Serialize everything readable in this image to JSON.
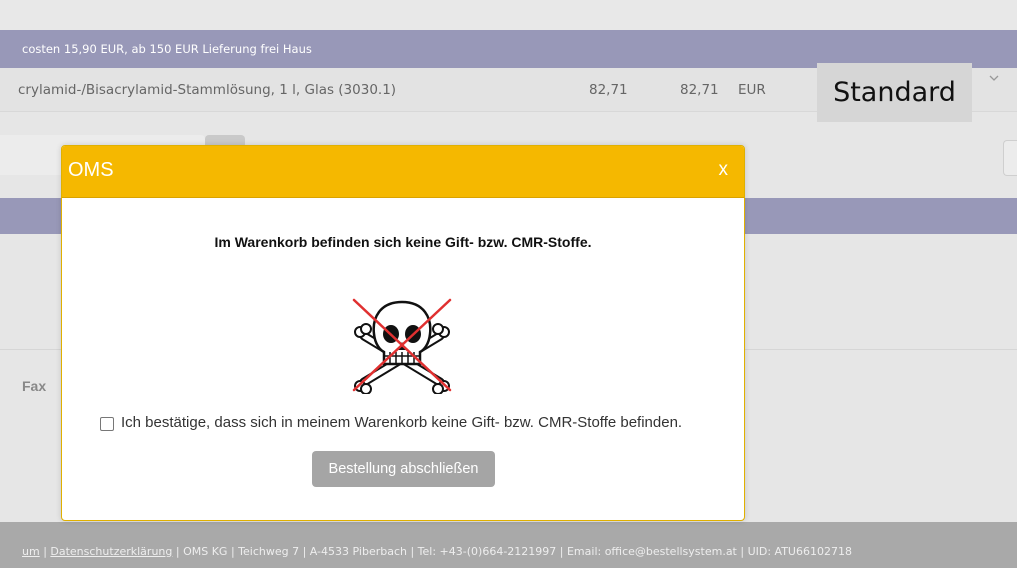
{
  "background": {
    "shipping_bar_text": "costen 15,90 EUR, ab 150 EUR Lieferung frei Haus",
    "product_row": {
      "name": "crylamid-/Bisacrylamid-Stammlösung, 1 l, Glas (3030.1)",
      "price": "82,71",
      "total": "82,71",
      "currency": "EUR",
      "dropdown_icon": "chevron-down-icon"
    },
    "fax_label": "Fax"
  },
  "tooltip": {
    "text": "Standard"
  },
  "modal": {
    "title": "OMS",
    "close_label": "x",
    "message": "Im Warenkorb befinden sich keine Gift- bzw. CMR-Stoffe.",
    "icon": "skull-crossed-out-icon",
    "confirm_label": "Ich bestätige, dass sich in meinem Warenkorb keine Gift- bzw. CMR-Stoffe befinden.",
    "confirm_checked": false,
    "submit_label": "Bestellung abschließen"
  },
  "footer": {
    "impressum_fragment": "um",
    "privacy_link": "Datenschutzerklärung",
    "company_info": " | OMS KG | Teichweg 7 | A-4533 Piberbach | Tel: +43-(0)664-2121997 | Email: office@bestellsystem.at | UID: ATU66102718"
  },
  "colors": {
    "modal_header": "#f5b800",
    "purple_band": "#9898b8",
    "submit_button": "#a5a5a5",
    "footer": "#a9a9a9",
    "cross": "#e03030"
  }
}
